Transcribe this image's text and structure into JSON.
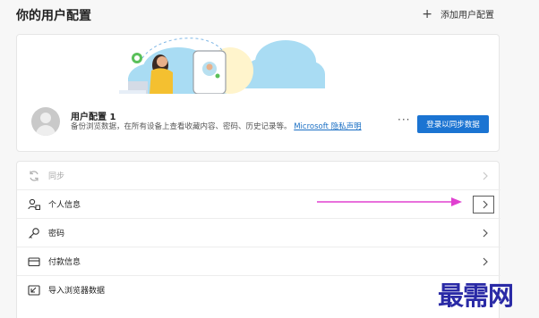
{
  "header": {
    "title": "你的用户配置",
    "add_profile_label": "添加用户配置"
  },
  "profile": {
    "name": "用户配置 1",
    "description": "备份浏览数据，在所有设备上查看收藏内容、密码、历史记录等。",
    "privacy_link": "Microsoft 隐私声明",
    "more_label": "···",
    "sync_button_label": "登录以同步数据"
  },
  "settings": {
    "items": [
      {
        "label": "同步",
        "icon": "sync-icon",
        "disabled": true
      },
      {
        "label": "个人信息",
        "icon": "personal-info-icon",
        "disabled": false
      },
      {
        "label": "密码",
        "icon": "key-icon",
        "disabled": false
      },
      {
        "label": "付款信息",
        "icon": "credit-card-icon",
        "disabled": false
      },
      {
        "label": "导入浏览器数据",
        "icon": "import-icon",
        "disabled": false
      }
    ]
  },
  "colors": {
    "accent": "#1b74d2",
    "annotation_arrow": "#e040d0",
    "cloud": "#a9dcf3",
    "watermark": "#2a2aa6"
  },
  "watermark": {
    "text": "最需网"
  }
}
